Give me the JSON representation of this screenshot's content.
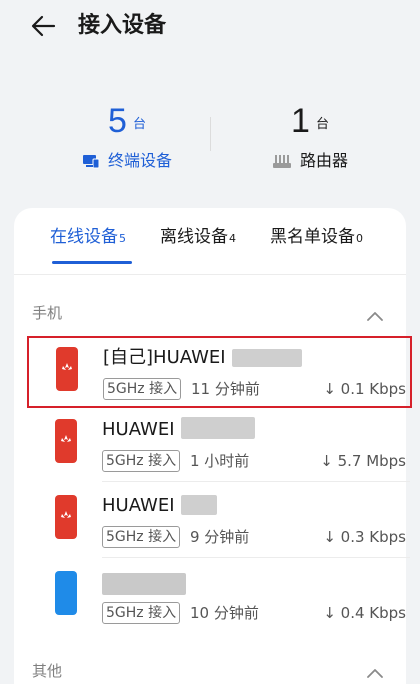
{
  "header": {
    "title": "接入设备",
    "back_icon": "arrow-left-icon"
  },
  "summary": {
    "terminal": {
      "count": "5",
      "unit": "台",
      "label": "终端设备",
      "icon": "monitor-icon"
    },
    "router": {
      "count": "1",
      "unit": "台",
      "label": "路由器",
      "icon": "router-icon"
    }
  },
  "tabs": [
    {
      "label": "在线设备",
      "count": "5",
      "active": true
    },
    {
      "label": "离线设备",
      "count": "4",
      "active": false
    },
    {
      "label": "黑名单设备",
      "count": "0",
      "active": false
    }
  ],
  "sections": [
    {
      "label": "手机",
      "expanded": true
    },
    {
      "label": "其他",
      "expanded": true
    }
  ],
  "devices": [
    {
      "name": "[自己]HUAWEI",
      "band": "5GHz 接入",
      "time": "11 分钟前",
      "speed": "↓ 0.1 Kbps",
      "color": "red",
      "highlighted": true
    },
    {
      "name": "HUAWEI",
      "band": "5GHz 接入",
      "time": "1 小时前",
      "speed": "↓ 5.7 Mbps",
      "color": "red",
      "highlighted": false
    },
    {
      "name": "HUAWEI",
      "band": "5GHz 接入",
      "time": "9 分钟前",
      "speed": "↓ 0.3 Kbps",
      "color": "red",
      "highlighted": false
    },
    {
      "name": "",
      "band": "5GHz 接入",
      "time": "10 分钟前",
      "speed": "↓ 0.4 Kbps",
      "color": "blue",
      "highlighted": false
    }
  ],
  "colors": {
    "accent": "#1f5fd6",
    "highlight_border": "#d6202a",
    "phone_red": "#e03a2c",
    "phone_blue": "#1f8be8"
  }
}
